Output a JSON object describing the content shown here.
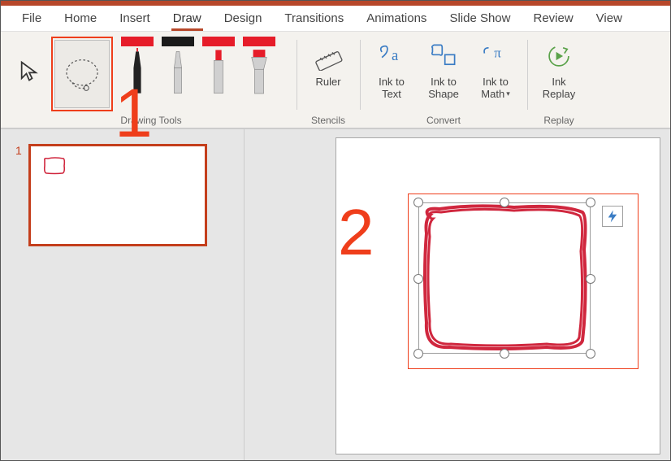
{
  "tabs": {
    "file": "File",
    "home": "Home",
    "insert": "Insert",
    "draw": "Draw",
    "design": "Design",
    "transitions": "Transitions",
    "animations": "Animations",
    "slide_show": "Slide Show",
    "review": "Review",
    "view": "View"
  },
  "ribbon": {
    "groups": {
      "drawing_tools": "Drawing Tools",
      "stencils": "Stencils",
      "convert": "Convert",
      "replay": "Replay"
    },
    "ruler": "Ruler",
    "ink_to_text_l1": "Ink to",
    "ink_to_text_l2": "Text",
    "ink_to_shape_l1": "Ink to",
    "ink_to_shape_l2": "Shape",
    "ink_to_math_l1": "Ink to",
    "ink_to_math_l2": "Math",
    "ink_replay_l1": "Ink",
    "ink_replay_l2": "Replay"
  },
  "annotations": {
    "step1": "1",
    "step2": "2"
  },
  "sidebar": {
    "slide1_num": "1"
  }
}
